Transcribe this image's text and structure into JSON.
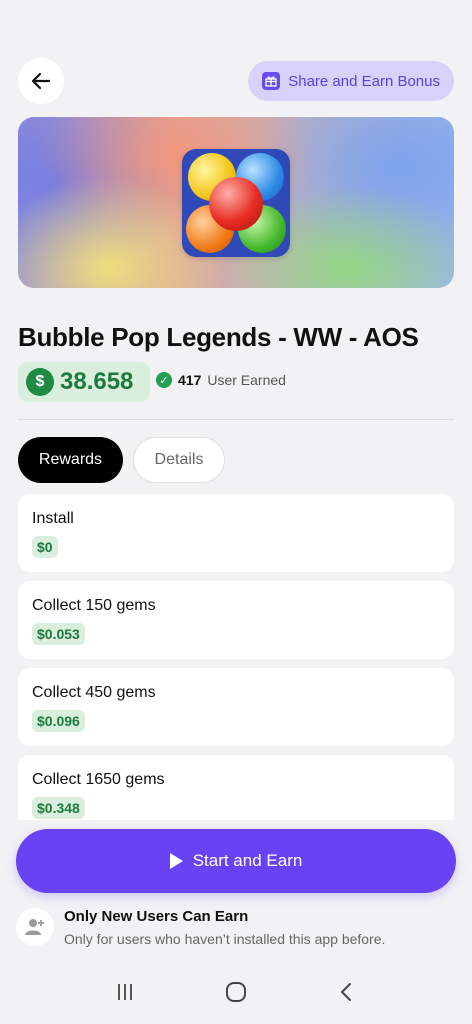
{
  "header": {
    "back_icon": "arrow-left-icon",
    "share_label": "Share and Earn Bonus",
    "share_icon": "gift-icon"
  },
  "app": {
    "title": "Bubble Pop Legends - WW - AOS",
    "coins": "38.658",
    "earned_count": "417",
    "earned_label": "User Earned"
  },
  "tabs": [
    {
      "label": "Rewards",
      "active": true
    },
    {
      "label": "Details",
      "active": false
    }
  ],
  "rewards": [
    {
      "title": "Install",
      "amount": "$0"
    },
    {
      "title": "Collect 150  gems",
      "amount": "$0.053"
    },
    {
      "title": "Collect 450  gems",
      "amount": "$0.096"
    },
    {
      "title": "Collect 1650  gems",
      "amount": "$0.348"
    }
  ],
  "cta": {
    "label": "Start and Earn"
  },
  "notice": {
    "title": "Only New Users Can Earn",
    "subtitle": "Only for users who haven’t installed this app before."
  },
  "colors": {
    "accent": "#6a42f5",
    "green": "#1d7a3e",
    "green_bg": "#d9eedd"
  }
}
